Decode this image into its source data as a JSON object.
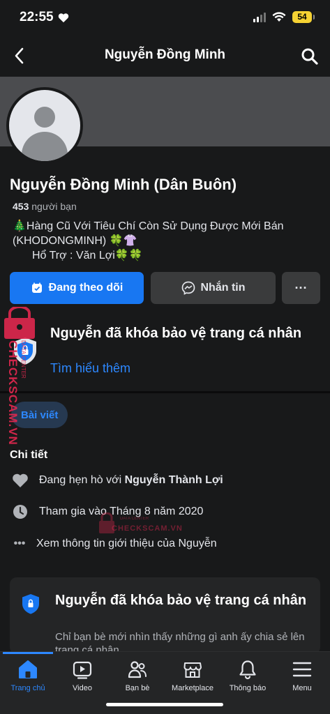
{
  "status_bar": {
    "time": "22:55",
    "battery": "54",
    "heart_icon": "heart-icon"
  },
  "nav": {
    "title": "Nguyễn Đồng Minh",
    "back_icon": "chevron-left-icon",
    "search_icon": "search-icon"
  },
  "profile": {
    "name": "Nguyễn Đồng Minh (Dân Buôn)",
    "friend_count": "453",
    "friend_label": "người bạn",
    "bio_line1": "🎄Hàng Cũ Với Tiêu Chí Còn Sử Dụng Được Mới Bán",
    "bio_line2": "(KHODONGMINH) 🍀👚",
    "bio_line3": "Hổ Trợ : Văn Lợi🍀🍀"
  },
  "actions": {
    "follow_label": "Đang theo dõi",
    "message_label": "Nhắn tin",
    "more_label": "···"
  },
  "lock_notice": {
    "title": "Nguyễn đã khóa bảo vệ trang cá nhân",
    "learn_more": "Tìm hiểu thêm"
  },
  "tabs": {
    "posts": "Bài viết"
  },
  "details": {
    "title": "Chi tiết",
    "dating_prefix": "Đang hẹn hò với",
    "dating_partner": "Nguyễn Thành Lợi",
    "joined": "Tham gia vào Tháng 8 năm 2020",
    "see_about": "Xem thông tin giới thiệu của Nguyễn"
  },
  "lock_card": {
    "title": "Nguyễn đã khóa bảo vệ trang cá nhân",
    "text": "Chỉ bạn bè mới nhìn thấy những gì anh ấy chia sẻ lên trang cá nhân."
  },
  "bottom_nav": [
    {
      "label": "Trang chủ",
      "icon": "home-icon",
      "active": true
    },
    {
      "label": "Video",
      "icon": "video-icon"
    },
    {
      "label": "Bạn bè",
      "icon": "friends-icon"
    },
    {
      "label": "Marketplace",
      "icon": "marketplace-icon"
    },
    {
      "label": "Thông báo",
      "icon": "bell-icon"
    },
    {
      "label": "Menu",
      "icon": "menu-icon"
    }
  ],
  "watermark": {
    "text": "CHECKSCAM.VN",
    "sub": "DATA CENTER"
  },
  "colors": {
    "accent": "#1877f2",
    "link": "#2d88ff",
    "background": "#18191a",
    "watermark": "#e0284f"
  }
}
